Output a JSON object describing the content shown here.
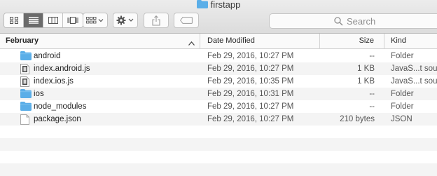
{
  "window": {
    "title": "firstapp"
  },
  "toolbar": {
    "view_buttons": [
      "icon-view",
      "list-view",
      "column-view",
      "cover-flow-view"
    ],
    "arrange_button": "arrange",
    "action_button": "action",
    "share_button": "share",
    "tags_button": "tags",
    "search_placeholder": "Search"
  },
  "columns": {
    "name": "February",
    "date": "Date Modified",
    "size": "Size",
    "kind": "Kind"
  },
  "files": [
    {
      "name": "android",
      "date": "Feb 29, 2016, 10:27 PM",
      "size": "--",
      "kind": "Folder",
      "icon": "folder-icon"
    },
    {
      "name": "index.android.js",
      "date": "Feb 29, 2016, 10:27 PM",
      "size": "1 KB",
      "kind": "JavaS...t source",
      "icon": "js-file-icon"
    },
    {
      "name": "index.ios.js",
      "date": "Feb 29, 2016, 10:35 PM",
      "size": "1 KB",
      "kind": "JavaS...t source",
      "icon": "js-file-icon"
    },
    {
      "name": "ios",
      "date": "Feb 29, 2016, 10:31 PM",
      "size": "--",
      "kind": "Folder",
      "icon": "folder-icon"
    },
    {
      "name": "node_modules",
      "date": "Feb 29, 2016, 10:27 PM",
      "size": "--",
      "kind": "Folder",
      "icon": "folder-icon"
    },
    {
      "name": "package.json",
      "date": "Feb 29, 2016, 10:27 PM",
      "size": "210 bytes",
      "kind": "JSON",
      "icon": "document-icon"
    }
  ],
  "colors": {
    "folder": "#5aaee8",
    "active_view": "#6b6b6b"
  }
}
